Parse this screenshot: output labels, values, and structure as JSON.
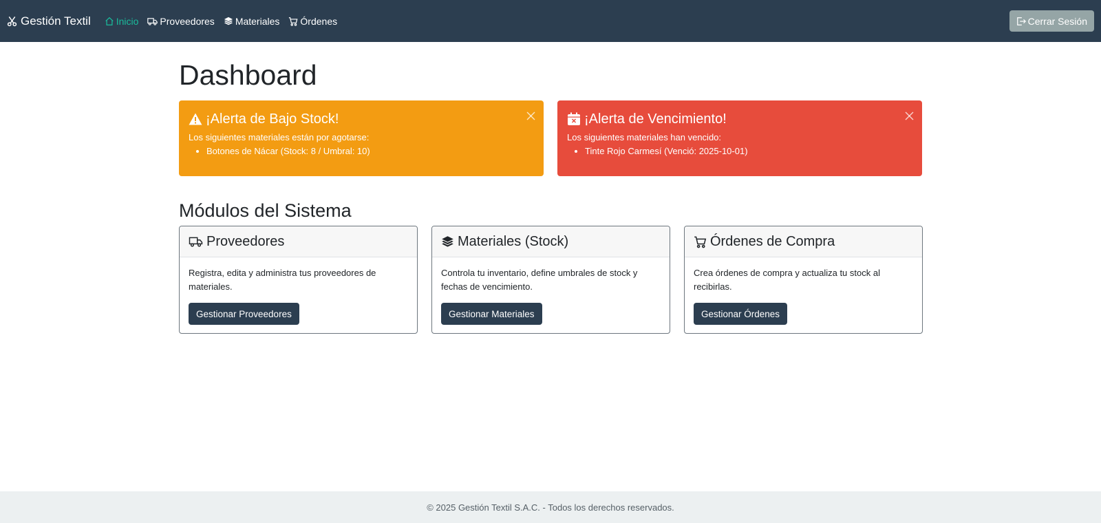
{
  "navbar": {
    "brand": "Gestión Textil",
    "items": [
      {
        "label": "Inicio",
        "icon": "house-icon"
      },
      {
        "label": "Proveedores",
        "icon": "truck-icon"
      },
      {
        "label": "Materiales",
        "icon": "layers-icon"
      },
      {
        "label": "Órdenes",
        "icon": "cart-icon"
      }
    ],
    "logout_label": "Cerrar Sesión"
  },
  "page": {
    "title": "Dashboard",
    "modules_title": "Módulos del Sistema"
  },
  "alerts": {
    "low_stock": {
      "heading": "¡Alerta de Bajo Stock!",
      "text": "Los siguientes materiales están por agotarse:",
      "items": [
        "Botones de Nácar (Stock: 8 / Umbral: 10)"
      ]
    },
    "expiry": {
      "heading": "¡Alerta de Vencimiento!",
      "text": "Los siguientes materiales han vencido:",
      "items": [
        "Tinte Rojo Carmesí (Venció: 2025-10-01)"
      ]
    }
  },
  "modules": [
    {
      "title": "Proveedores",
      "text": "Registra, edita y administra tus proveedores de materiales.",
      "button": "Gestionar Proveedores",
      "icon": "truck-icon"
    },
    {
      "title": "Materiales (Stock)",
      "text": "Controla tu inventario, define umbrales de stock y fechas de vencimiento.",
      "button": "Gestionar Materiales",
      "icon": "layers-icon"
    },
    {
      "title": "Órdenes de Compra",
      "text": "Crea órdenes de compra y actualiza tu stock al recibirlas.",
      "button": "Gestionar Órdenes",
      "icon": "cart-icon"
    }
  ],
  "footer": {
    "text": "© 2025 Gestión Textil S.A.C. - Todos los derechos reservados."
  },
  "colors": {
    "navbar": "#2c3e50",
    "active_link": "#1abc9c",
    "warning": "#f39c12",
    "danger": "#e74c3c",
    "secondary": "#95a5a6",
    "footer_bg": "#ecf0f1"
  }
}
